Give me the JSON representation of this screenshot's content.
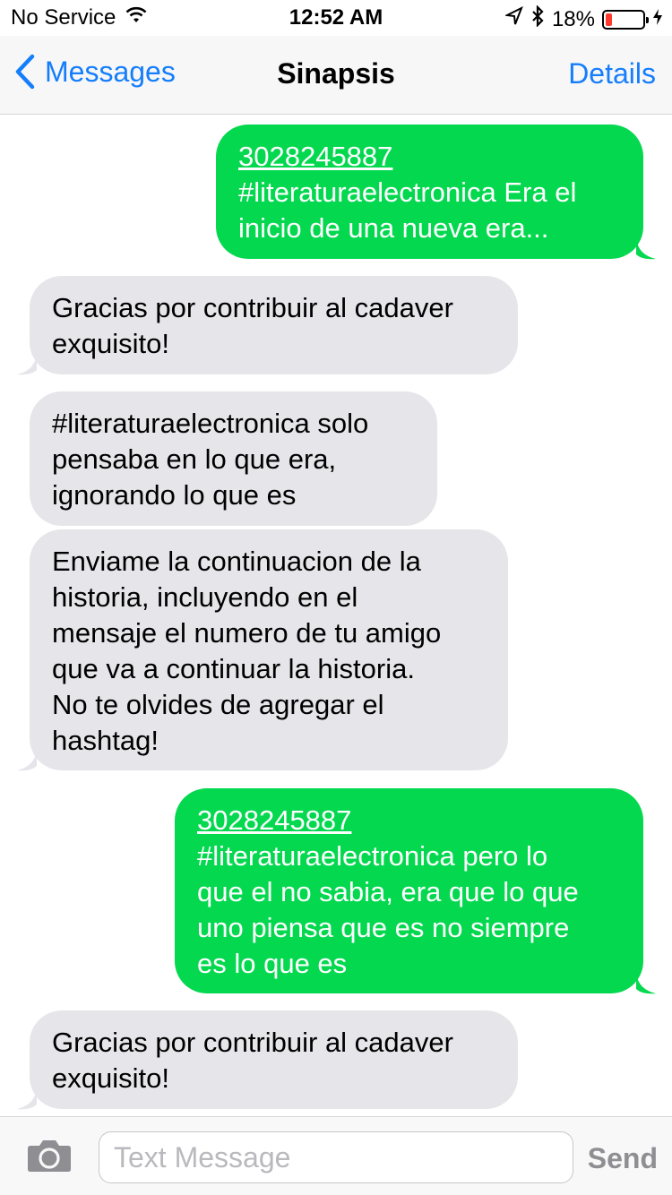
{
  "status": {
    "carrier": "No Service",
    "time": "12:52 AM",
    "battery_percent": "18%",
    "battery_level": 0.18,
    "icons": [
      "wifi-icon",
      "location-arrow-icon",
      "bluetooth-icon",
      "battery-icon",
      "charging-bolt-icon"
    ]
  },
  "nav": {
    "back_label": "Messages",
    "title": "Sinapsis",
    "details_label": "Details"
  },
  "messages": [
    {
      "direction": "outgoing",
      "number": "3028245887",
      "lines": [
        "#literaturaelectronica Era el",
        "inicio de una nueva era..."
      ]
    },
    {
      "direction": "incoming",
      "lines": [
        "Gracias por contribuir al cadaver",
        "exquisito!"
      ]
    },
    {
      "direction": "incoming",
      "lines": [
        "#literaturaelectronica solo",
        "pensaba en lo que era,",
        "ignorando lo que es"
      ]
    },
    {
      "direction": "incoming",
      "lines": [
        "Enviame la continuacion de la",
        "historia, incluyendo en el",
        "mensaje el numero de tu amigo",
        "que va a continuar la historia.",
        "No te olvides de agregar el",
        "hashtag!"
      ]
    },
    {
      "direction": "outgoing",
      "number": "3028245887",
      "lines": [
        "#literaturaelectronica pero lo",
        "que el no sabia, era que lo que",
        "uno piensa que es no siempre",
        "es lo que es"
      ]
    },
    {
      "direction": "incoming",
      "lines": [
        "Gracias por contribuir al cadaver",
        "exquisito!"
      ]
    }
  ],
  "composer": {
    "placeholder": "Text Message",
    "send_label": "Send"
  },
  "colors": {
    "outgoing_bubble": "#04d84f",
    "incoming_bubble": "#e5e5ea",
    "accent": "#157efb",
    "battery_low": "#ff3b30"
  }
}
